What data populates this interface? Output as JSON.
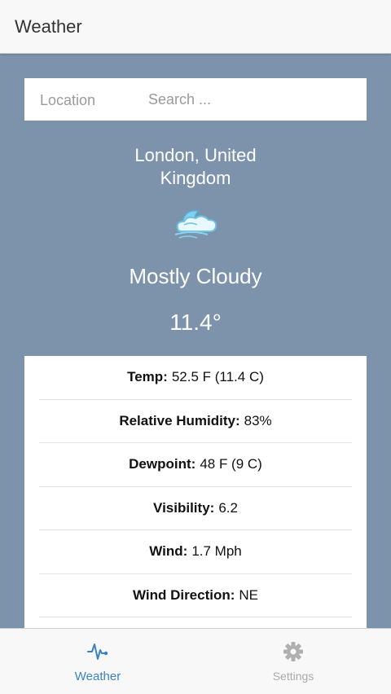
{
  "header": {
    "title": "Weather"
  },
  "search": {
    "label": "Location",
    "placeholder": "Search ..."
  },
  "location": {
    "line1": "London, United",
    "line2": "Kingdom"
  },
  "current": {
    "icon": "partly-cloudy-icon",
    "condition": "Mostly Cloudy",
    "temperature": "11.4°"
  },
  "details": [
    {
      "label": "Temp:",
      "value": "52.5 F (11.4 C)"
    },
    {
      "label": "Relative Humidity:",
      "value": "83%"
    },
    {
      "label": "Dewpoint:",
      "value": "48 F (9 C)"
    },
    {
      "label": "Visibility:",
      "value": "6.2"
    },
    {
      "label": "Wind:",
      "value": "1.7 Mph"
    },
    {
      "label": "Wind Direction:",
      "value": "NE"
    }
  ],
  "tabs": [
    {
      "label": "Weather",
      "icon": "pulse-icon",
      "active": true,
      "color": "#3a82c4"
    },
    {
      "label": "Settings",
      "icon": "gear-icon",
      "active": false,
      "color": "#aaaaaa"
    }
  ],
  "colors": {
    "background": "#7d93ac",
    "accent": "#3a82c4"
  }
}
